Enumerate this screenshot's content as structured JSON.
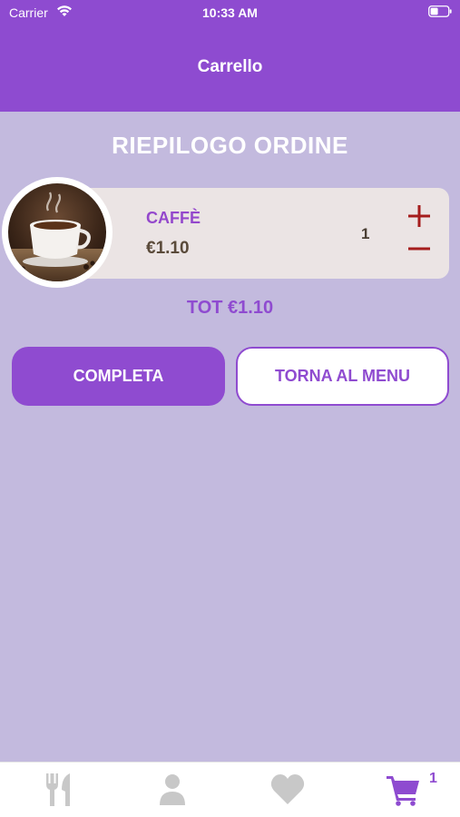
{
  "status_bar": {
    "carrier": "Carrier",
    "time": "10:33 AM"
  },
  "header": {
    "title": "Carrello"
  },
  "summary": {
    "heading": "RIEPILOGO ORDINE"
  },
  "cart": {
    "items": [
      {
        "name": "CAFFÈ",
        "price": "€1.10",
        "quantity": "1",
        "image_icon": "coffee-cup-photo"
      }
    ],
    "total": "TOT €1.10"
  },
  "actions": {
    "complete_label": "COMPLETA",
    "back_to_menu_label": "TORNA AL MENU"
  },
  "tab_bar": {
    "tabs": [
      {
        "icon": "utensils-icon",
        "active": false
      },
      {
        "icon": "user-icon",
        "active": false
      },
      {
        "icon": "heart-icon",
        "active": false
      },
      {
        "icon": "cart-icon",
        "active": true
      }
    ],
    "cart_badge": "1"
  },
  "colors": {
    "primary": "#8e4bd0",
    "background": "#c3bade",
    "card": "#ebe4e4",
    "quantity_control": "#a51d1d",
    "inactive_icon": "#c8c8c8"
  }
}
